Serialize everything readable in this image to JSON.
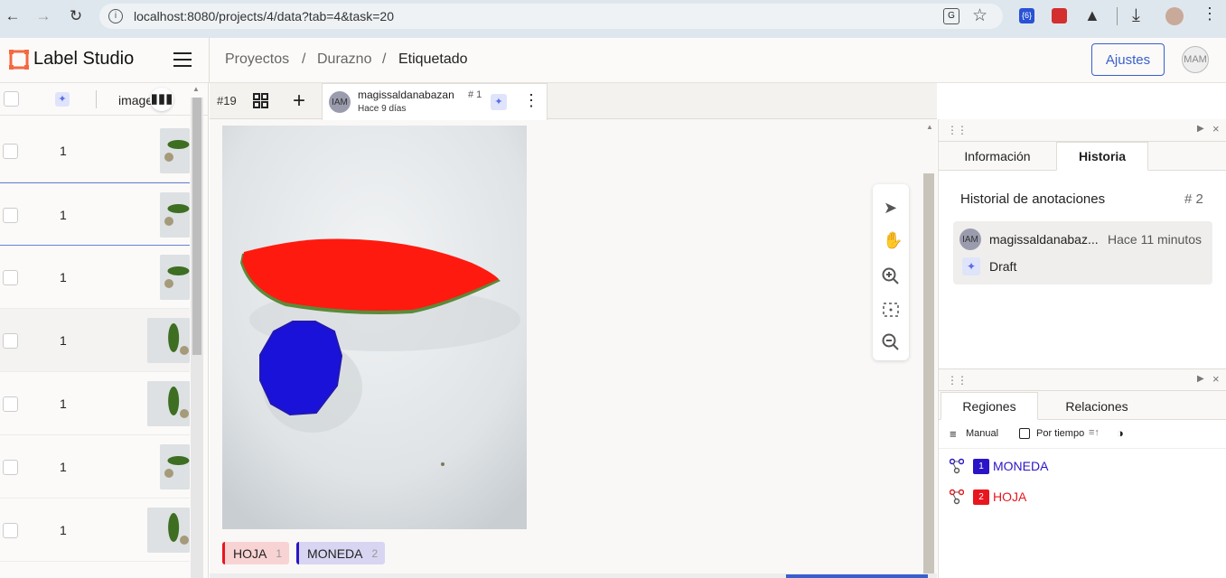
{
  "browser": {
    "url": "localhost:8080/projects/4/data?tab=4&task=20",
    "ext1": "{6}"
  },
  "app": {
    "logo_text": "Label Studio",
    "breadcrumbs": [
      "Proyectos",
      "Durazno",
      "Etiquetado"
    ],
    "settings_label": "Ajustes",
    "user_initials": "MAM"
  },
  "task_list": {
    "column_header": "image",
    "rows": [
      {
        "value": "1"
      },
      {
        "value": "1"
      },
      {
        "value": "1"
      },
      {
        "value": "1"
      },
      {
        "value": "1"
      },
      {
        "value": "1"
      },
      {
        "value": "1"
      }
    ]
  },
  "annotation_tabs": {
    "task_id": "#19",
    "annotator": "magissaldanabazan",
    "annotation_num": "# 1",
    "time": "Hace 9 días",
    "avatar_initials": "IAM"
  },
  "labels": [
    {
      "name": "HOJA",
      "count": "1",
      "color": "#e8161f"
    },
    {
      "name": "MONEDA",
      "count": "2",
      "color": "#2b14c7"
    }
  ],
  "info_panel": {
    "tabs": [
      "Información",
      "Historia"
    ],
    "history_title": "Historial de anotaciones",
    "history_count": "# 2",
    "entry_user": "magissaldanabaz...",
    "entry_time": "Hace 11 minutos",
    "entry_avatar": "IAM",
    "entry_state": "Draft"
  },
  "regions_panel": {
    "tabs": [
      "Regiones",
      "Relaciones"
    ],
    "order_label": "Manual",
    "sort_label": "Por tiempo",
    "regions": [
      {
        "index": "1",
        "label": "MONEDA",
        "color": "#2b14c7"
      },
      {
        "index": "2",
        "label": "HOJA",
        "color": "#e8161f"
      }
    ]
  }
}
